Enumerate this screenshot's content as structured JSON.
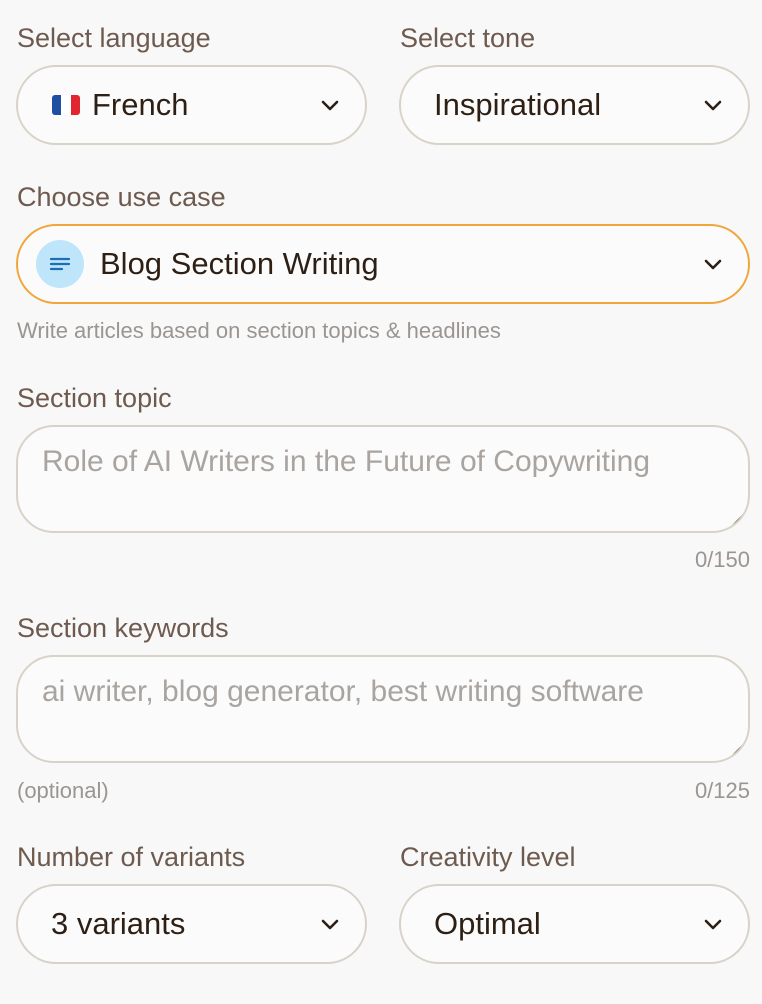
{
  "language": {
    "label": "Select language",
    "value": "French",
    "flag_colors": [
      "#1f4fa3",
      "#ffffff",
      "#e0262f"
    ]
  },
  "tone": {
    "label": "Select tone",
    "value": "Inspirational"
  },
  "use_case": {
    "label": "Choose use case",
    "value": "Blog Section Writing",
    "icon": "lines-icon",
    "description": "Write articles based on section topics & headlines"
  },
  "section_topic": {
    "label": "Section topic",
    "placeholder": "Role of AI Writers in the Future of Copywriting",
    "counter": "0/150"
  },
  "section_keywords": {
    "label": "Section keywords",
    "placeholder": "ai writer, blog generator, best writing software",
    "optional": "(optional)",
    "counter": "0/125"
  },
  "variants": {
    "label": "Number of variants",
    "value": "3 variants"
  },
  "creativity": {
    "label": "Creativity level",
    "value": "Optimal"
  },
  "colors": {
    "accent_border": "#f0a63a",
    "icon_bg": "#bfe5fb",
    "icon_fg": "#1d6fb3"
  }
}
